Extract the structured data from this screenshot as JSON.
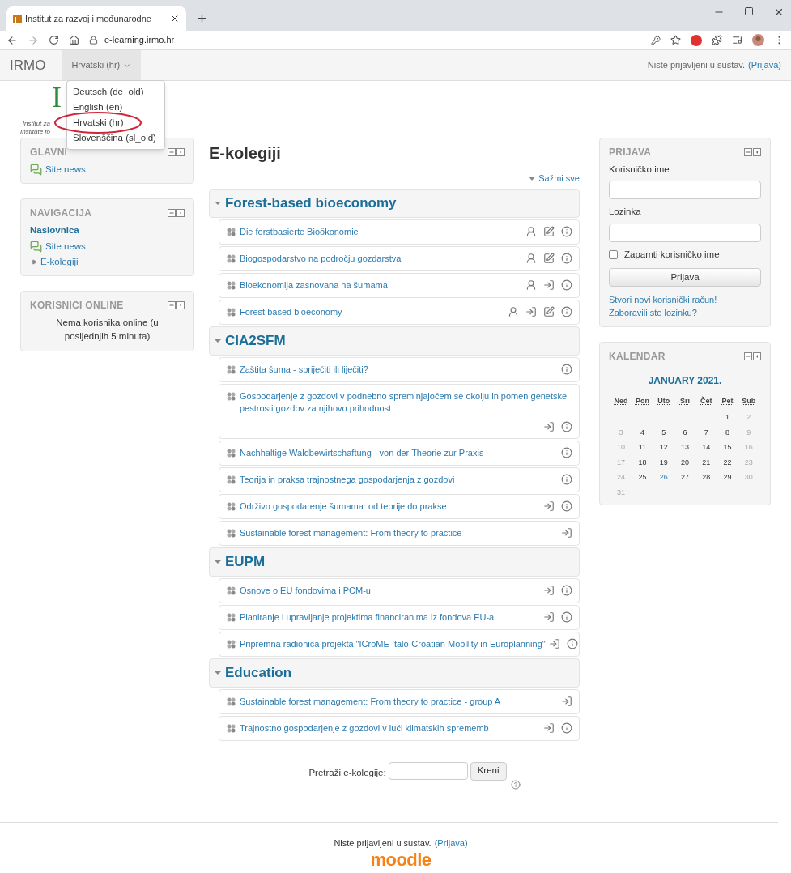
{
  "browser": {
    "tab_title": "Institut za razvoj i međunarodne",
    "url": "e-learning.irmo.hr"
  },
  "navbar": {
    "brand": "IRMO",
    "language": "Hrvatski (hr)",
    "login_text": "Niste prijavljeni u sustav.",
    "login_link": "(Prijava)"
  },
  "language_menu": [
    {
      "label": "Deutsch (de_old)",
      "circled": false
    },
    {
      "label": "English (en)",
      "circled": false
    },
    {
      "label": "Hrvatski (hr)",
      "circled": true
    },
    {
      "label": "Slovenščina (sl_old)",
      "circled": false
    }
  ],
  "logo": {
    "letter": "I",
    "lines": [
      "Institut za",
      "Institute fo"
    ]
  },
  "left_blocks": [
    {
      "title": "GLAVNI",
      "items": [
        {
          "kind": "news",
          "label": "Site news"
        }
      ]
    },
    {
      "title": "NAVIGACIJA",
      "items": [
        {
          "kind": "home",
          "label": "Naslovnica"
        },
        {
          "kind": "news",
          "label": "Site news"
        },
        {
          "kind": "branch",
          "label": "E-kolegiji"
        }
      ]
    },
    {
      "title": "KORISNICI ONLINE",
      "items": [
        {
          "kind": "note",
          "label": "Nema korisnika online (u posljednjih 5 minuta)"
        }
      ]
    }
  ],
  "main": {
    "title": "E-kolegiji",
    "collapse_all": "Sažmi sve",
    "categories": [
      {
        "name": "Forest-based bioeconomy",
        "expanded": true,
        "courses": [
          {
            "name": "Die forstbasierte Bioökonomie",
            "icons": [
              {
                "kind": "guest"
              },
              {
                "kind": "edit"
              },
              {
                "kind": "info"
              }
            ]
          },
          {
            "name": "Biogospodarstvo na področju gozdarstva",
            "icons": [
              {
                "kind": "guest"
              },
              {
                "kind": "edit"
              },
              {
                "kind": "info"
              }
            ]
          },
          {
            "name": "Bioekonomija zasnovana na šumama",
            "icons": [
              {
                "kind": "guest"
              },
              {
                "kind": "enrol"
              },
              {
                "kind": "info"
              }
            ]
          },
          {
            "name": "Forest based bioeconomy",
            "icons": [
              {
                "kind": "guest"
              },
              {
                "kind": "enrol"
              },
              {
                "kind": "edit"
              },
              {
                "kind": "info"
              }
            ]
          }
        ]
      },
      {
        "name": "CIA2SFM",
        "expanded": true,
        "courses": [
          {
            "name": "Zaštita šuma - spriječiti ili liječiti?",
            "icons": [
              {
                "kind": "info"
              }
            ]
          },
          {
            "name": "Gospodarjenje z gozdovi v podnebno spreminjajočem se okolju in pomen genetske pestrosti gozdov za njihovo prihodnost",
            "icons": [
              {
                "kind": "enrol"
              },
              {
                "kind": "info"
              }
            ]
          },
          {
            "name": "Nachhaltige Waldbewirtschaftung - von der Theorie zur Praxis",
            "icons": [
              {
                "kind": "info"
              }
            ]
          },
          {
            "name": "Teorija in praksa trajnostnega gospodarjenja z gozdovi",
            "icons": [
              {
                "kind": "info"
              }
            ]
          },
          {
            "name": "Održivo gospodarenje šumama: od teorije do prakse",
            "icons": [
              {
                "kind": "enrol"
              },
              {
                "kind": "info"
              }
            ]
          },
          {
            "name": "Sustainable forest management: From theory to practice",
            "icons": [
              {
                "kind": "enrol"
              }
            ]
          }
        ]
      },
      {
        "name": "EUPM",
        "expanded": true,
        "courses": [
          {
            "name": "Osnove o EU fondovima i PCM-u",
            "icons": [
              {
                "kind": "enrol"
              },
              {
                "kind": "info"
              }
            ]
          },
          {
            "name": "Planiranje i upravljanje projektima financiranima iz fondova EU-a",
            "icons": [
              {
                "kind": "enrol"
              },
              {
                "kind": "info"
              }
            ]
          },
          {
            "name": "Pripremna radionica projekta \"ICroME Italo-Croatian Mobility in Europlanning\"",
            "icons": [
              {
                "kind": "enrol"
              },
              {
                "kind": "info"
              }
            ]
          }
        ]
      },
      {
        "name": "Education",
        "expanded": true,
        "courses": [
          {
            "name": "Sustainable forest management: From theory to practice - group A",
            "icons": [
              {
                "kind": "enrol"
              }
            ]
          },
          {
            "name": "Trajnostno gospodarjenje z gozdovi v luči klimatskih sprememb",
            "icons": [
              {
                "kind": "enrol"
              },
              {
                "kind": "info"
              }
            ]
          }
        ]
      }
    ],
    "search": {
      "label": "Pretraži e-kolegije:",
      "button": "Kreni"
    }
  },
  "login_block": {
    "title": "PRIJAVA",
    "username_label": "Korisničko ime",
    "password_label": "Lozinka",
    "remember": {
      "label": "Zapamti korisničko ime",
      "checked": false
    },
    "button": "Prijava",
    "links": [
      "Stvori novi korisnički račun!",
      "Zaboravili ste lozinku?"
    ]
  },
  "calendar": {
    "title": "KALENDAR",
    "month": "JANUARY 2021.",
    "weekdays": [
      "Ned",
      "Pon",
      "Uto",
      "Sri",
      "Čet",
      "Pet",
      "Sub"
    ],
    "weeks": [
      [
        {
          "kind": "blank"
        },
        {
          "kind": "blank"
        },
        {
          "kind": "blank"
        },
        {
          "kind": "blank"
        },
        {
          "kind": "blank"
        },
        {
          "kind": "day",
          "label": "1",
          "today": false
        },
        {
          "kind": "day",
          "label": "2",
          "today": false
        }
      ],
      [
        {
          "kind": "day",
          "label": "3",
          "today": false
        },
        {
          "kind": "day",
          "label": "4",
          "today": false
        },
        {
          "kind": "day",
          "label": "5",
          "today": false
        },
        {
          "kind": "day",
          "label": "6",
          "today": false
        },
        {
          "kind": "day",
          "label": "7",
          "today": false
        },
        {
          "kind": "day",
          "label": "8",
          "today": false
        },
        {
          "kind": "day",
          "label": "9",
          "today": false
        }
      ],
      [
        {
          "kind": "day",
          "label": "10",
          "today": false
        },
        {
          "kind": "day",
          "label": "11",
          "today": false
        },
        {
          "kind": "day",
          "label": "12",
          "today": false
        },
        {
          "kind": "day",
          "label": "13",
          "today": false
        },
        {
          "kind": "day",
          "label": "14",
          "today": false
        },
        {
          "kind": "day",
          "label": "15",
          "today": false
        },
        {
          "kind": "day",
          "label": "16",
          "today": false
        }
      ],
      [
        {
          "kind": "day",
          "label": "17",
          "today": false
        },
        {
          "kind": "day",
          "label": "18",
          "today": false
        },
        {
          "kind": "day",
          "label": "19",
          "today": false
        },
        {
          "kind": "day",
          "label": "20",
          "today": false
        },
        {
          "kind": "day",
          "label": "21",
          "today": false
        },
        {
          "kind": "day",
          "label": "22",
          "today": false
        },
        {
          "kind": "day",
          "label": "23",
          "today": false
        }
      ],
      [
        {
          "kind": "day",
          "label": "24",
          "today": false
        },
        {
          "kind": "day",
          "label": "25",
          "today": false
        },
        {
          "kind": "day",
          "label": "26",
          "today": true
        },
        {
          "kind": "day",
          "label": "27",
          "today": false
        },
        {
          "kind": "day",
          "label": "28",
          "today": false
        },
        {
          "kind": "day",
          "label": "29",
          "today": false
        },
        {
          "kind": "day",
          "label": "30",
          "today": false
        }
      ],
      [
        {
          "kind": "day",
          "label": "31",
          "today": false
        }
      ]
    ]
  },
  "footer": {
    "login_text": "Niste prijavljeni u sustav.",
    "login_link": "(Prijava)",
    "logo_text": "moodle"
  }
}
